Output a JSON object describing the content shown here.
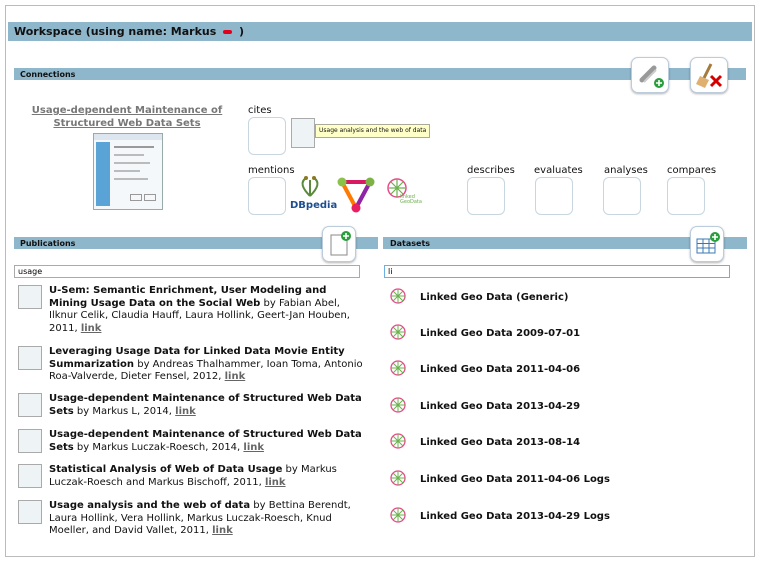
{
  "workspace": {
    "title": "Workspace (using name: Markus",
    "title_suffix": ")"
  },
  "connections": {
    "label": "Connections",
    "main_publication": "Usage-dependent Maintenance of Structured Web Data Sets",
    "relations": {
      "cites": "cites",
      "mentions": "mentions",
      "describes": "describes",
      "evaluates": "evaluates",
      "analyses": "analyses",
      "compares": "compares"
    },
    "cites_tooltip": "Usage analysis and the web of data",
    "dbpedia_logo_text": "DBpedia",
    "lgd_logo_text": "linked GeoData"
  },
  "publications": {
    "label": "Publications",
    "search_value": "usage",
    "items": [
      {
        "title": "U-Sem: Semantic Enrichment, User Modeling and Mining Usage Data on the Social Web",
        "by": " by Fabian Abel, Ilknur Celik, Claudia Hauff, Laura Hollink, Geert-Jan Houben, 2011, ",
        "link": "link"
      },
      {
        "title": "Leveraging Usage Data for Linked Data Movie Entity Summarization",
        "by": " by Andreas Thalhammer, Ioan Toma, Antonio Roa-Valverde, Dieter Fensel, 2012, ",
        "link": "link"
      },
      {
        "title": "Usage-dependent Maintenance of Structured Web Data Sets",
        "by": " by Markus L, 2014, ",
        "link": "link"
      },
      {
        "title": "Usage-dependent Maintenance of Structured Web Data Sets",
        "by": " by Markus Luczak-Roesch, 2014, ",
        "link": "link"
      },
      {
        "title": "Statistical Analysis of Web of Data Usage",
        "by": " by Markus Luczak-Roesch and Markus Bischoff, 2011, ",
        "link": "link"
      },
      {
        "title": "Usage analysis and the web of data",
        "by": " by Bettina Berendt, Laura Hollink, Vera Hollink, Markus Luczak-Roesch, Knud Moeller, and David Vallet, 2011, ",
        "link": "link"
      }
    ]
  },
  "datasets": {
    "label": "Datasets",
    "search_value": "li",
    "items": [
      "Linked Geo Data (Generic)",
      "Linked Geo Data 2009-07-01",
      "Linked Geo Data 2011-04-06",
      "Linked Geo Data 2013-04-29",
      "Linked Geo Data 2013-08-14",
      "Linked Geo Data 2011-04-06 Logs",
      "Linked Geo Data 2013-04-29 Logs"
    ]
  },
  "colors": {
    "bar": "#8fb7cc",
    "accent_red": "#e2001a",
    "add_green": "#2a9d3c",
    "link_gray": "#666666"
  },
  "icons": {
    "add_connection": "link-add-icon",
    "clear": "broom-clear-icon",
    "add_publication": "document-add-icon",
    "add_dataset": "table-add-icon"
  }
}
